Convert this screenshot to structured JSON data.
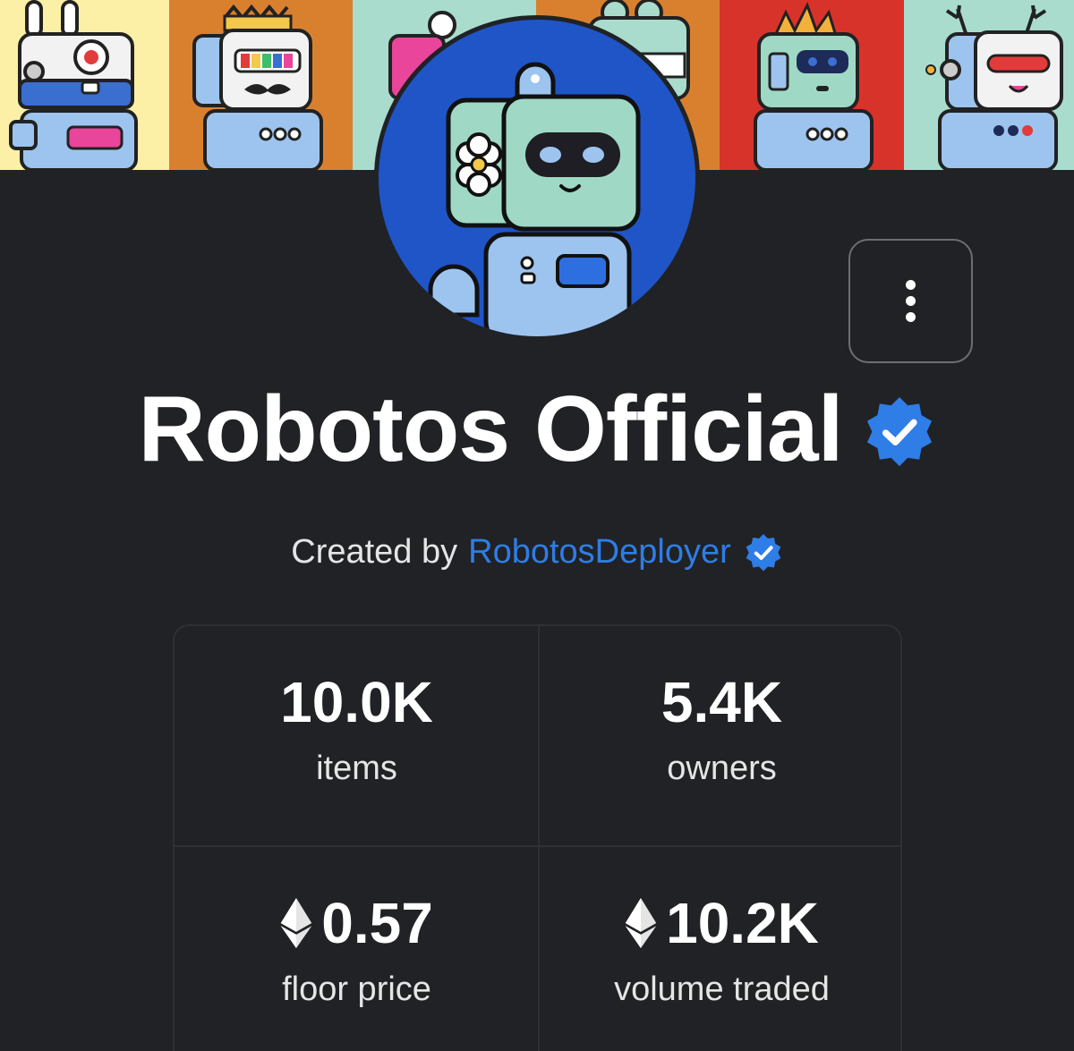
{
  "collection": {
    "title": "Robotos Official",
    "creator_prefix": "Created by",
    "creator_name": "RobotosDeployer"
  },
  "stats": [
    {
      "value": "10.0K",
      "label": "items",
      "eth": false
    },
    {
      "value": "5.4K",
      "label": "owners",
      "eth": false
    },
    {
      "value": "0.57",
      "label": "floor price",
      "eth": true
    },
    {
      "value": "10.2K",
      "label": "volume traded",
      "eth": true
    }
  ],
  "colors": {
    "background": "#202225",
    "verified_badge": "#2f7de6",
    "creator_link": "#2f7de6",
    "avatar_bg": "#1f55c7"
  },
  "banner_tiles": [
    {
      "bg": "#fbf0a6",
      "robot": "bunny-robot"
    },
    {
      "bg": "#d9802f",
      "robot": "king-robot"
    },
    {
      "bg": "#a9dccd",
      "robot": "antenna-robot"
    },
    {
      "bg": "#d9802f",
      "robot": "frog-robot"
    },
    {
      "bg": "#d8332b",
      "robot": "spiky-robot"
    },
    {
      "bg": "#a9dccd",
      "robot": "antler-robot"
    }
  ],
  "icons": {
    "more": "vertical-ellipsis-icon",
    "verified": "verified-badge-icon",
    "eth": "ethereum-icon"
  }
}
